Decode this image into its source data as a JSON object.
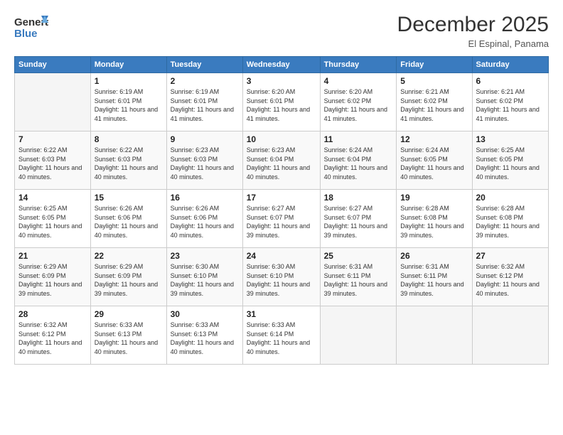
{
  "logo": {
    "line1": "General",
    "line2": "Blue"
  },
  "title": "December 2025",
  "location": "El Espinal, Panama",
  "days_header": [
    "Sunday",
    "Monday",
    "Tuesday",
    "Wednesday",
    "Thursday",
    "Friday",
    "Saturday"
  ],
  "weeks": [
    [
      {
        "day": "",
        "sunrise": "",
        "sunset": "",
        "daylight": ""
      },
      {
        "day": "1",
        "sunrise": "Sunrise: 6:19 AM",
        "sunset": "Sunset: 6:01 PM",
        "daylight": "Daylight: 11 hours and 41 minutes."
      },
      {
        "day": "2",
        "sunrise": "Sunrise: 6:19 AM",
        "sunset": "Sunset: 6:01 PM",
        "daylight": "Daylight: 11 hours and 41 minutes."
      },
      {
        "day": "3",
        "sunrise": "Sunrise: 6:20 AM",
        "sunset": "Sunset: 6:01 PM",
        "daylight": "Daylight: 11 hours and 41 minutes."
      },
      {
        "day": "4",
        "sunrise": "Sunrise: 6:20 AM",
        "sunset": "Sunset: 6:02 PM",
        "daylight": "Daylight: 11 hours and 41 minutes."
      },
      {
        "day": "5",
        "sunrise": "Sunrise: 6:21 AM",
        "sunset": "Sunset: 6:02 PM",
        "daylight": "Daylight: 11 hours and 41 minutes."
      },
      {
        "day": "6",
        "sunrise": "Sunrise: 6:21 AM",
        "sunset": "Sunset: 6:02 PM",
        "daylight": "Daylight: 11 hours and 41 minutes."
      }
    ],
    [
      {
        "day": "7",
        "sunrise": "Sunrise: 6:22 AM",
        "sunset": "Sunset: 6:03 PM",
        "daylight": "Daylight: 11 hours and 40 minutes."
      },
      {
        "day": "8",
        "sunrise": "Sunrise: 6:22 AM",
        "sunset": "Sunset: 6:03 PM",
        "daylight": "Daylight: 11 hours and 40 minutes."
      },
      {
        "day": "9",
        "sunrise": "Sunrise: 6:23 AM",
        "sunset": "Sunset: 6:03 PM",
        "daylight": "Daylight: 11 hours and 40 minutes."
      },
      {
        "day": "10",
        "sunrise": "Sunrise: 6:23 AM",
        "sunset": "Sunset: 6:04 PM",
        "daylight": "Daylight: 11 hours and 40 minutes."
      },
      {
        "day": "11",
        "sunrise": "Sunrise: 6:24 AM",
        "sunset": "Sunset: 6:04 PM",
        "daylight": "Daylight: 11 hours and 40 minutes."
      },
      {
        "day": "12",
        "sunrise": "Sunrise: 6:24 AM",
        "sunset": "Sunset: 6:05 PM",
        "daylight": "Daylight: 11 hours and 40 minutes."
      },
      {
        "day": "13",
        "sunrise": "Sunrise: 6:25 AM",
        "sunset": "Sunset: 6:05 PM",
        "daylight": "Daylight: 11 hours and 40 minutes."
      }
    ],
    [
      {
        "day": "14",
        "sunrise": "Sunrise: 6:25 AM",
        "sunset": "Sunset: 6:05 PM",
        "daylight": "Daylight: 11 hours and 40 minutes."
      },
      {
        "day": "15",
        "sunrise": "Sunrise: 6:26 AM",
        "sunset": "Sunset: 6:06 PM",
        "daylight": "Daylight: 11 hours and 40 minutes."
      },
      {
        "day": "16",
        "sunrise": "Sunrise: 6:26 AM",
        "sunset": "Sunset: 6:06 PM",
        "daylight": "Daylight: 11 hours and 40 minutes."
      },
      {
        "day": "17",
        "sunrise": "Sunrise: 6:27 AM",
        "sunset": "Sunset: 6:07 PM",
        "daylight": "Daylight: 11 hours and 39 minutes."
      },
      {
        "day": "18",
        "sunrise": "Sunrise: 6:27 AM",
        "sunset": "Sunset: 6:07 PM",
        "daylight": "Daylight: 11 hours and 39 minutes."
      },
      {
        "day": "19",
        "sunrise": "Sunrise: 6:28 AM",
        "sunset": "Sunset: 6:08 PM",
        "daylight": "Daylight: 11 hours and 39 minutes."
      },
      {
        "day": "20",
        "sunrise": "Sunrise: 6:28 AM",
        "sunset": "Sunset: 6:08 PM",
        "daylight": "Daylight: 11 hours and 39 minutes."
      }
    ],
    [
      {
        "day": "21",
        "sunrise": "Sunrise: 6:29 AM",
        "sunset": "Sunset: 6:09 PM",
        "daylight": "Daylight: 11 hours and 39 minutes."
      },
      {
        "day": "22",
        "sunrise": "Sunrise: 6:29 AM",
        "sunset": "Sunset: 6:09 PM",
        "daylight": "Daylight: 11 hours and 39 minutes."
      },
      {
        "day": "23",
        "sunrise": "Sunrise: 6:30 AM",
        "sunset": "Sunset: 6:10 PM",
        "daylight": "Daylight: 11 hours and 39 minutes."
      },
      {
        "day": "24",
        "sunrise": "Sunrise: 6:30 AM",
        "sunset": "Sunset: 6:10 PM",
        "daylight": "Daylight: 11 hours and 39 minutes."
      },
      {
        "day": "25",
        "sunrise": "Sunrise: 6:31 AM",
        "sunset": "Sunset: 6:11 PM",
        "daylight": "Daylight: 11 hours and 39 minutes."
      },
      {
        "day": "26",
        "sunrise": "Sunrise: 6:31 AM",
        "sunset": "Sunset: 6:11 PM",
        "daylight": "Daylight: 11 hours and 39 minutes."
      },
      {
        "day": "27",
        "sunrise": "Sunrise: 6:32 AM",
        "sunset": "Sunset: 6:12 PM",
        "daylight": "Daylight: 11 hours and 40 minutes."
      }
    ],
    [
      {
        "day": "28",
        "sunrise": "Sunrise: 6:32 AM",
        "sunset": "Sunset: 6:12 PM",
        "daylight": "Daylight: 11 hours and 40 minutes."
      },
      {
        "day": "29",
        "sunrise": "Sunrise: 6:33 AM",
        "sunset": "Sunset: 6:13 PM",
        "daylight": "Daylight: 11 hours and 40 minutes."
      },
      {
        "day": "30",
        "sunrise": "Sunrise: 6:33 AM",
        "sunset": "Sunset: 6:13 PM",
        "daylight": "Daylight: 11 hours and 40 minutes."
      },
      {
        "day": "31",
        "sunrise": "Sunrise: 6:33 AM",
        "sunset": "Sunset: 6:14 PM",
        "daylight": "Daylight: 11 hours and 40 minutes."
      },
      {
        "day": "",
        "sunrise": "",
        "sunset": "",
        "daylight": ""
      },
      {
        "day": "",
        "sunrise": "",
        "sunset": "",
        "daylight": ""
      },
      {
        "day": "",
        "sunrise": "",
        "sunset": "",
        "daylight": ""
      }
    ]
  ]
}
